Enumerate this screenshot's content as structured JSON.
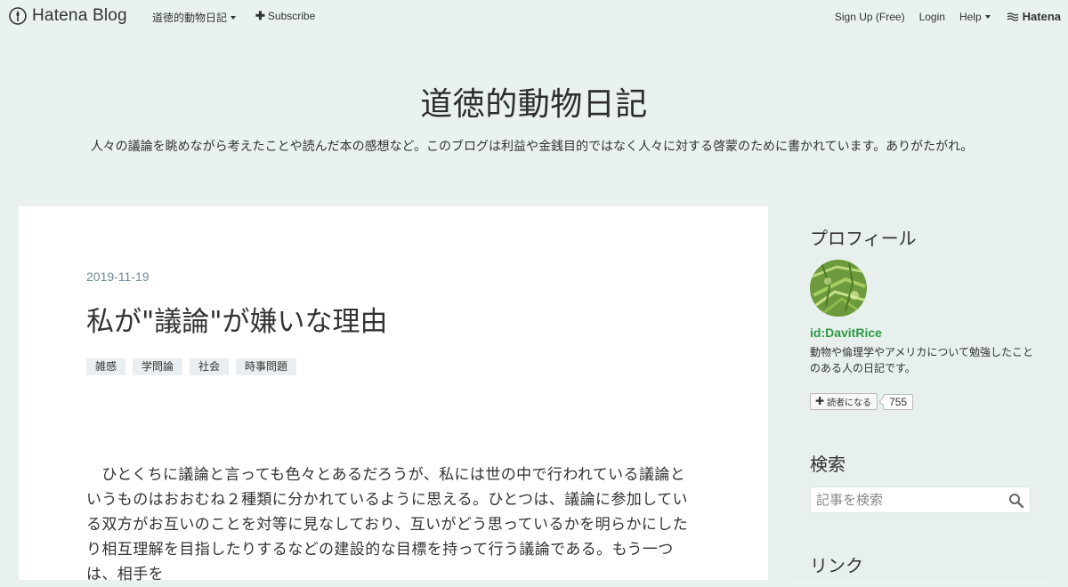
{
  "global_header": {
    "brand": "Hatena Blog",
    "blog_menu_label": "道徳的動物日記",
    "subscribe_label": "Subscribe",
    "signup_label": "Sign Up (Free)",
    "login_label": "Login",
    "help_label": "Help",
    "hatena_label": "Hatena"
  },
  "blog": {
    "title": "道徳的動物日記",
    "description": "人々の議論を眺めながら考えたことや読んだ本の感想など。このブログは利益や金銭目的ではなく人々に対する啓蒙のために書かれています。ありがたがれ。"
  },
  "entry": {
    "date": "2019-11-19",
    "title": "私が\"議論\"が嫌いな理由",
    "categories": [
      "雑感",
      "学問論",
      "社会",
      "時事問題"
    ],
    "body": "　ひとくちに議論と言っても色々とあるだろうが、私には世の中で行われている議論というものはおおむね２種類に分かれているように思える。ひとつは、議論に参加している双方がお互いのことを対等に見なしており、互いがどう思っているかを明らかにしたり相互理解を目指したりするなどの建設的な目標を持って行う議論である。もう一つは、相手を"
  },
  "sidebar": {
    "profile_heading": "プロフィール",
    "profile_id": "id:DavitRice",
    "profile_description": "動物や倫理学やアメリカについて勉強したことのある人の日記です。",
    "subscribe_button_label": "読者になる",
    "subscriber_count": "755",
    "search_heading": "検索",
    "search_placeholder": "記事を検索",
    "links_heading": "リンク"
  },
  "colors": {
    "page_background": "#e9f2ef",
    "profile_id": "#2c9a48",
    "date": "#6e8a94"
  }
}
